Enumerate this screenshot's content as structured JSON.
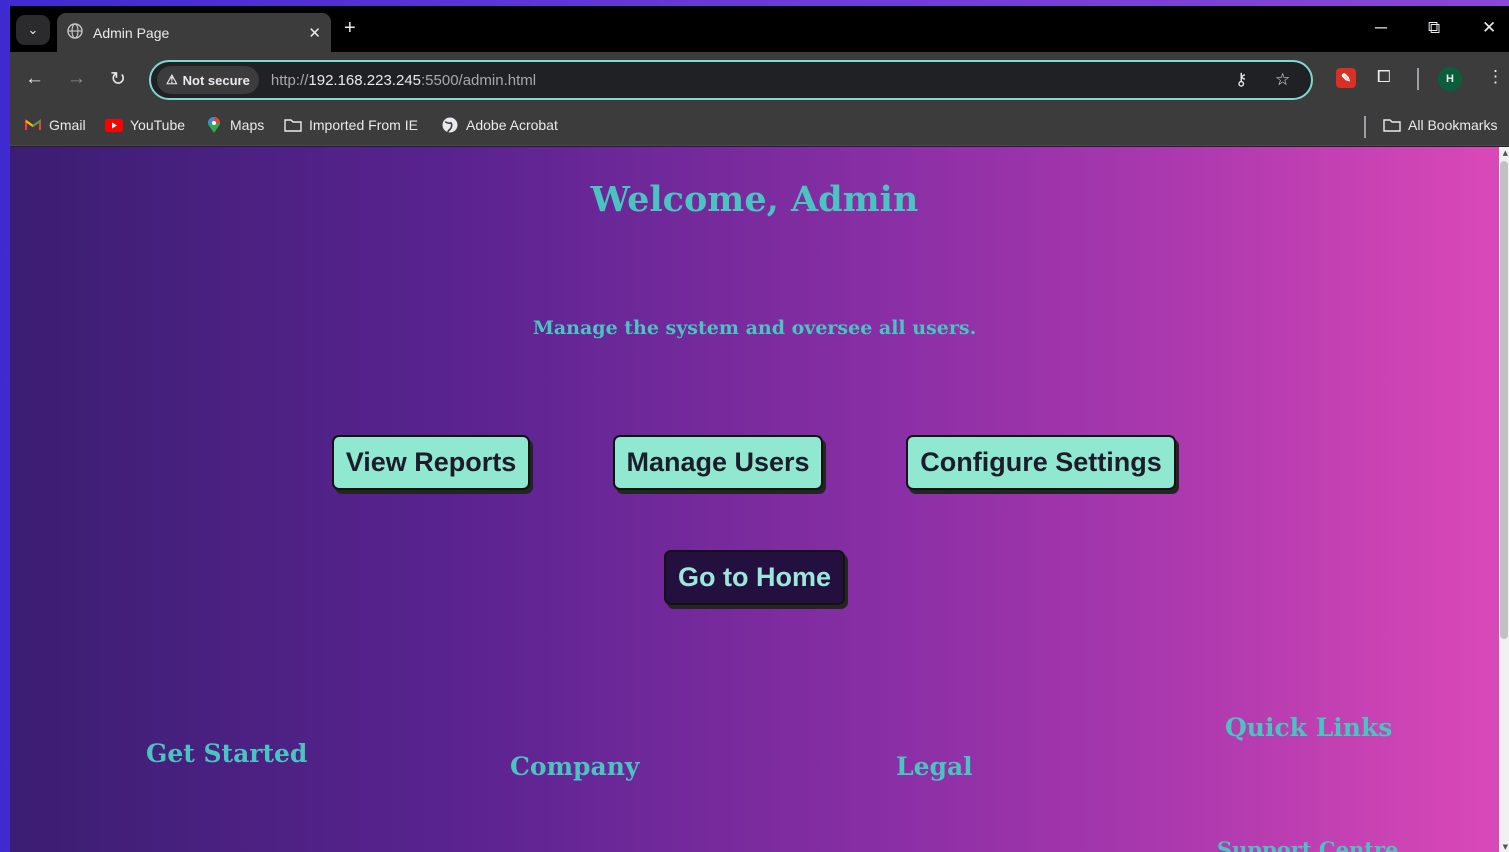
{
  "browser": {
    "tab": {
      "title": "Admin Page",
      "close_glyph": "✕"
    },
    "new_tab_glyph": "+",
    "window_controls": {
      "minimize": "─",
      "restore": "⧉",
      "close": "✕"
    },
    "address": {
      "security_label": "Not secure",
      "url_scheme": "http://",
      "url_host": "192.168.223.245",
      "url_rest": ":5500/admin.html"
    },
    "profile_initial": "H",
    "bookmarks": [
      {
        "label": "Gmail",
        "icon": "gmail-icon"
      },
      {
        "label": "YouTube",
        "icon": "youtube-icon"
      },
      {
        "label": "Maps",
        "icon": "maps-icon"
      },
      {
        "label": "Imported From IE",
        "icon": "folder-icon"
      },
      {
        "label": "Adobe Acrobat",
        "icon": "globe-icon"
      }
    ],
    "all_bookmarks_label": "All Bookmarks"
  },
  "page": {
    "title": "Welcome, Admin",
    "subtitle": "Manage the system and oversee all users.",
    "actions": {
      "view_reports": "View Reports",
      "manage_users": "Manage Users",
      "configure_settings": "Configure Settings",
      "go_home": "Go to Home"
    },
    "footer": {
      "get_started": "Get Started",
      "company": "Company",
      "legal": "Legal",
      "quick_links": "Quick Links",
      "support_centre": "Support Centre"
    }
  },
  "colors": {
    "accent_teal": "#49c4c0",
    "button_bg": "#8fe8cf",
    "home_button_bg": "#24103e",
    "omnibox_border": "#7fd8d2"
  }
}
